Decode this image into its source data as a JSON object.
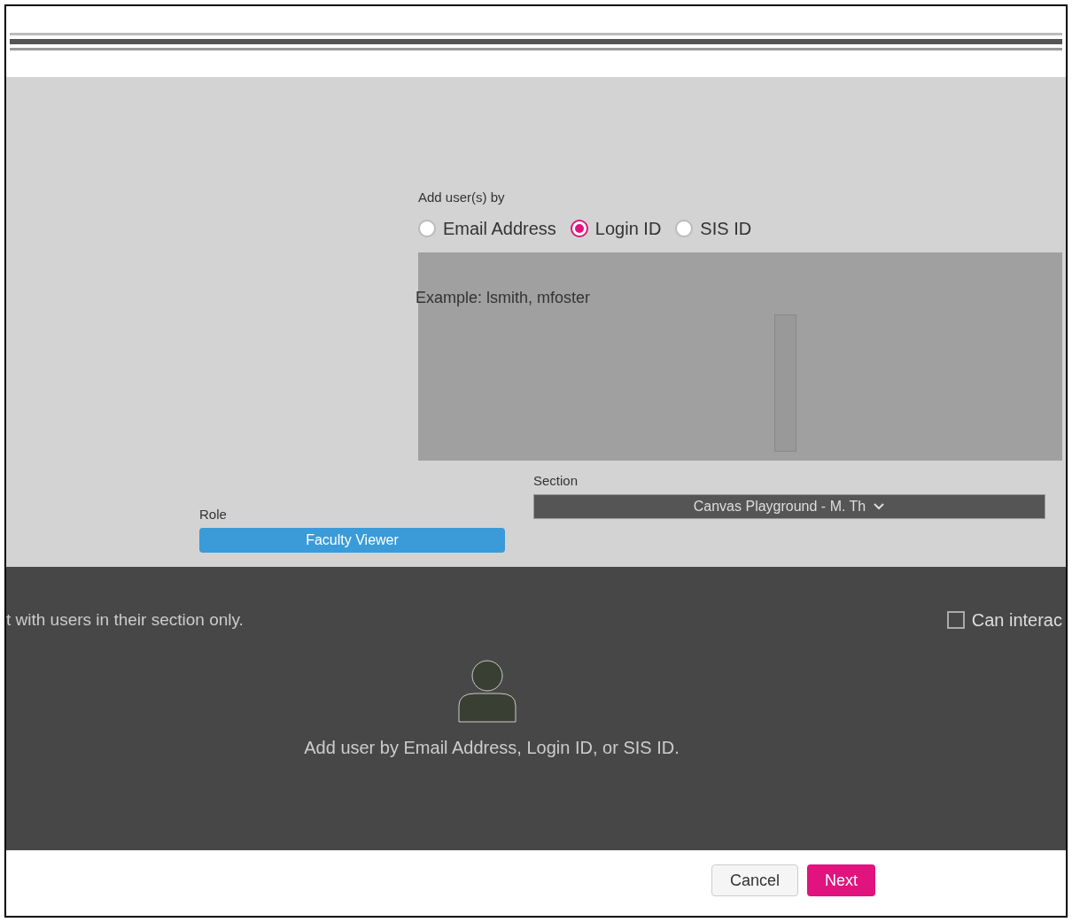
{
  "add_by": {
    "label": "Add user(s) by",
    "options": [
      {
        "label": "Email Address",
        "selected": false
      },
      {
        "label": "Login ID",
        "selected": true
      },
      {
        "label": "SIS ID",
        "selected": false
      }
    ]
  },
  "example": "Example: lsmith, mfoster",
  "role": {
    "label": "Role",
    "value": "Faculty Viewer"
  },
  "section": {
    "label": "Section",
    "value": "Canvas Playground - M. Th"
  },
  "section_limit_text": "t with users in their section only.",
  "interact": {
    "label": "Can interac",
    "checked": false
  },
  "empty_state": "Add user by Email Address, Login ID, or SIS ID.",
  "buttons": [
    {
      "label": "Cancel",
      "kind": "secondary"
    },
    {
      "label": "Next",
      "kind": "primary"
    }
  ]
}
